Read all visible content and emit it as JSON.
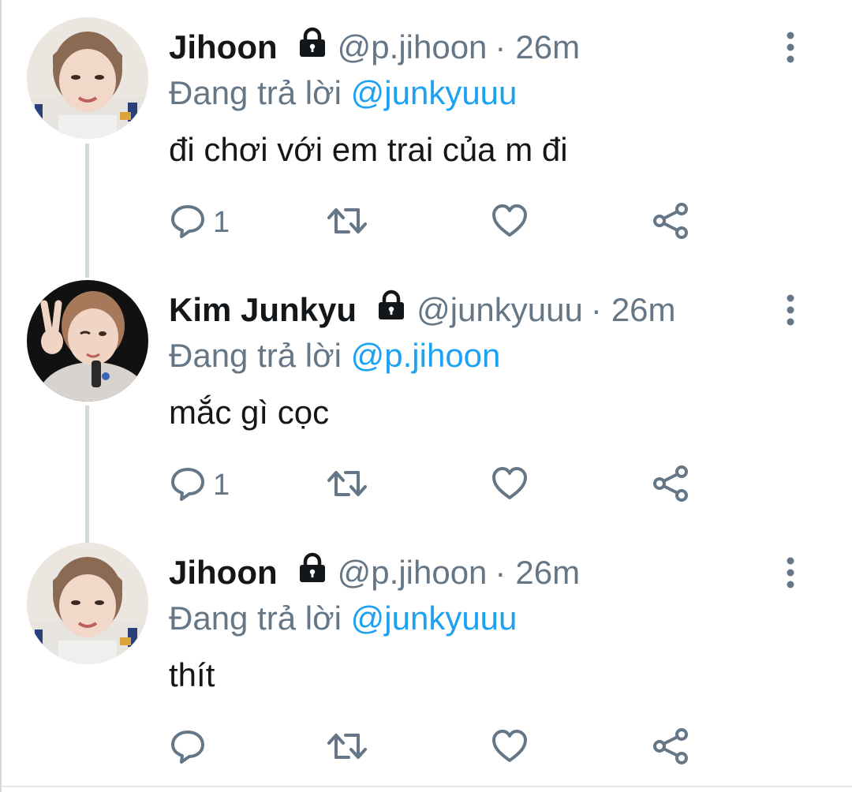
{
  "tweets": [
    {
      "name": "Jihoon",
      "handle": "@p.jihoon",
      "separator": "·",
      "time": "26m",
      "reply_prefix": "Đang trả lời",
      "reply_to": "@junkyuuu",
      "text": "đi chơi với em trai của m đi",
      "reply_count": "1"
    },
    {
      "name": "Kim Junkyu",
      "handle": "@junkyuuu",
      "separator": "·",
      "time": "26m",
      "reply_prefix": "Đang trả lời",
      "reply_to": "@p.jihoon",
      "text": "mắc gì cọc",
      "reply_count": "1"
    },
    {
      "name": "Jihoon",
      "handle": "@p.jihoon",
      "separator": "·",
      "time": "26m",
      "reply_prefix": "Đang trả lời",
      "reply_to": "@junkyuuu",
      "text": "thít",
      "reply_count": ""
    }
  ],
  "icons": {
    "lock": "lock-icon",
    "more": "more-vertical-icon",
    "reply": "reply-icon",
    "retweet": "retweet-icon",
    "like": "heart-icon",
    "share": "share-icon"
  },
  "colors": {
    "text": "#14171a",
    "secondary": "#657786",
    "mention": "#1da1f2",
    "thread_line": "#cfd9de"
  }
}
